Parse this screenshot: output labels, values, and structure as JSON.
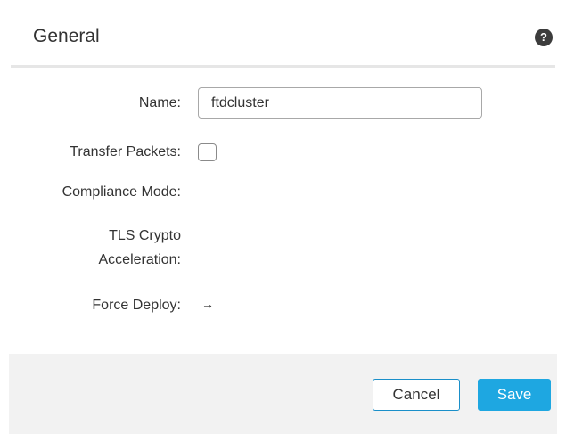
{
  "dialog": {
    "title": "General",
    "help_icon": "help-icon",
    "help_glyph": "?"
  },
  "form": {
    "name_label": "Name:",
    "name_value": "ftdcluster",
    "transfer_packets_label": "Transfer Packets:",
    "transfer_packets_checked": false,
    "compliance_mode_label": "Compliance Mode:",
    "tls_label_line1": "TLS Crypto",
    "tls_label_line2": "Acceleration:",
    "force_deploy_label": "Force Deploy:",
    "force_deploy_icon": "arrow-right-icon",
    "force_deploy_glyph": "→"
  },
  "footer": {
    "cancel_label": "Cancel",
    "save_label": "Save"
  },
  "colors": {
    "primary": "#1ea7e1",
    "text": "#333333",
    "footer_bg": "#f2f2f2"
  }
}
